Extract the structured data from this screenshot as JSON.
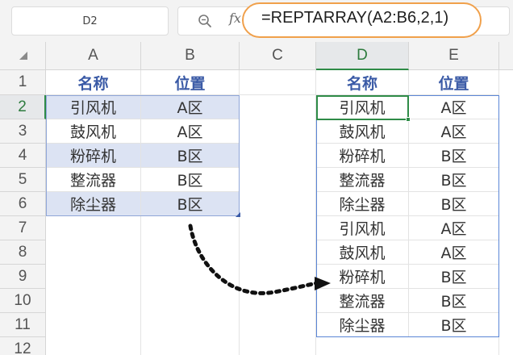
{
  "name_box": {
    "value": "D2"
  },
  "formula_bar": {
    "zoom_icon": "zoom-icon",
    "fx_label": "fx",
    "formula": "=REPTARRAY(A2:B6,2,1)",
    "highlight_color": "#f0a04b"
  },
  "columns": [
    "A",
    "B",
    "C",
    "D",
    "E"
  ],
  "rows": [
    "1",
    "2",
    "3",
    "4",
    "5",
    "6",
    "7",
    "8",
    "9",
    "10",
    "11",
    "12"
  ],
  "source_table": {
    "headers": [
      "名称",
      "位置"
    ],
    "rows": [
      [
        "引风机",
        "A区"
      ],
      [
        "鼓风机",
        "A区"
      ],
      [
        "粉碎机",
        "B区"
      ],
      [
        "整流器",
        "B区"
      ],
      [
        "除尘器",
        "B区"
      ]
    ]
  },
  "result_table": {
    "headers": [
      "名称",
      "位置"
    ],
    "rows": [
      [
        "引风机",
        "A区"
      ],
      [
        "鼓风机",
        "A区"
      ],
      [
        "粉碎机",
        "B区"
      ],
      [
        "整流器",
        "B区"
      ],
      [
        "除尘器",
        "B区"
      ],
      [
        "引风机",
        "A区"
      ],
      [
        "鼓风机",
        "A区"
      ],
      [
        "粉碎机",
        "B区"
      ],
      [
        "整流器",
        "B区"
      ],
      [
        "除尘器",
        "B区"
      ]
    ]
  },
  "colors": {
    "header_text": "#3a5aa6",
    "selection_fill": "#dce3f3",
    "active_green": "#2e8b47",
    "spill_border": "#5b86d6"
  }
}
